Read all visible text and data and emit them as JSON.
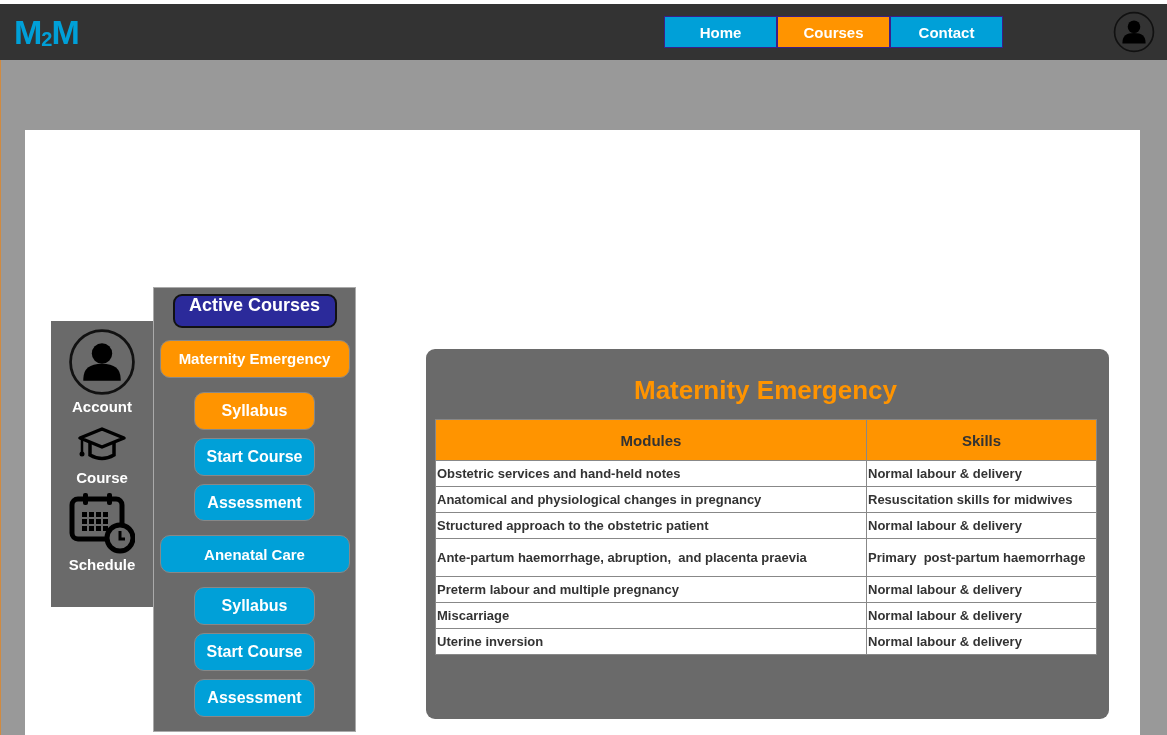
{
  "logo": "M$_{2}$M",
  "nav": [
    {
      "label": "Home",
      "selected": false
    },
    {
      "label": "Courses",
      "selected": true
    },
    {
      "label": "Contact",
      "selected": false
    }
  ],
  "sidebar": {
    "items": [
      {
        "kind": "account",
        "label": "Account"
      },
      {
        "kind": "course",
        "label": "Course"
      },
      {
        "kind": "schedule",
        "label": "Schedule"
      }
    ]
  },
  "active_courses": {
    "title": "Active Courses",
    "courses": [
      {
        "label": "Maternity Emergency",
        "selected": true,
        "actions": [
          {
            "label": "Syllabus",
            "selected": true
          },
          {
            "label": "Start Course",
            "selected": false
          },
          {
            "label": "Assessment",
            "selected": false
          }
        ]
      },
      {
        "label": "Anenatal Care",
        "selected": false,
        "actions": [
          {
            "label": "Syllabus",
            "selected": false
          },
          {
            "label": "Start Course",
            "selected": false
          },
          {
            "label": "Assessment",
            "selected": false
          }
        ]
      }
    ]
  },
  "course_panel": {
    "title": "Maternity Emergency",
    "table": {
      "columns": [
        "Modules",
        "Skills"
      ],
      "rows": [
        [
          "Obstetric services and hand-held notes",
          "Normal labour & delivery"
        ],
        [
          "Anatomical and physiological changes in pregnancy",
          "Resuscitation skills for midwives"
        ],
        [
          "Structured approach to the obstetric patient",
          "Normal labour & delivery"
        ],
        [
          "Ante-partum haemorrhage, abruption,  and placenta praevia",
          "Primary  post-partum haemorrhage"
        ],
        [
          "Preterm labour and multiple pregnancy",
          "Normal labour & delivery"
        ],
        [
          "Miscarriage",
          "Normal labour & delivery"
        ],
        [
          "Uterine inversion",
          "Normal labour & delivery"
        ]
      ]
    }
  }
}
